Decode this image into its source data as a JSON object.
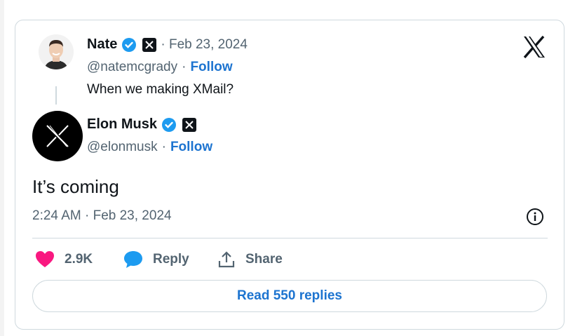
{
  "quoted": {
    "name": "Nate",
    "date": "· Feb 23, 2024",
    "handle": "@natemcgrady",
    "separator": "·",
    "follow": "Follow",
    "text": "When we making XMail?"
  },
  "tweet": {
    "name": "Elon Musk",
    "handle": "@elonmusk",
    "separator": "·",
    "follow": "Follow",
    "text": "It’s coming",
    "timestamp": "2:24 AM · Feb 23, 2024"
  },
  "actions": {
    "likes": "2.9K",
    "reply": "Reply",
    "share": "Share"
  },
  "read_replies": "Read 550 replies",
  "icons": {
    "brand": "x-logo-icon",
    "verified": "verified-badge-icon",
    "affiliate": "x-affiliate-badge-icon",
    "info": "info-icon",
    "like": "heart-icon",
    "reply": "speech-bubble-icon",
    "share": "share-icon"
  },
  "colors": {
    "accent": "#1d74d0",
    "verified": "#1d9bf0",
    "heart": "#f91880",
    "text": "#0f1419",
    "muted": "#536471",
    "border": "#cfd9de"
  }
}
